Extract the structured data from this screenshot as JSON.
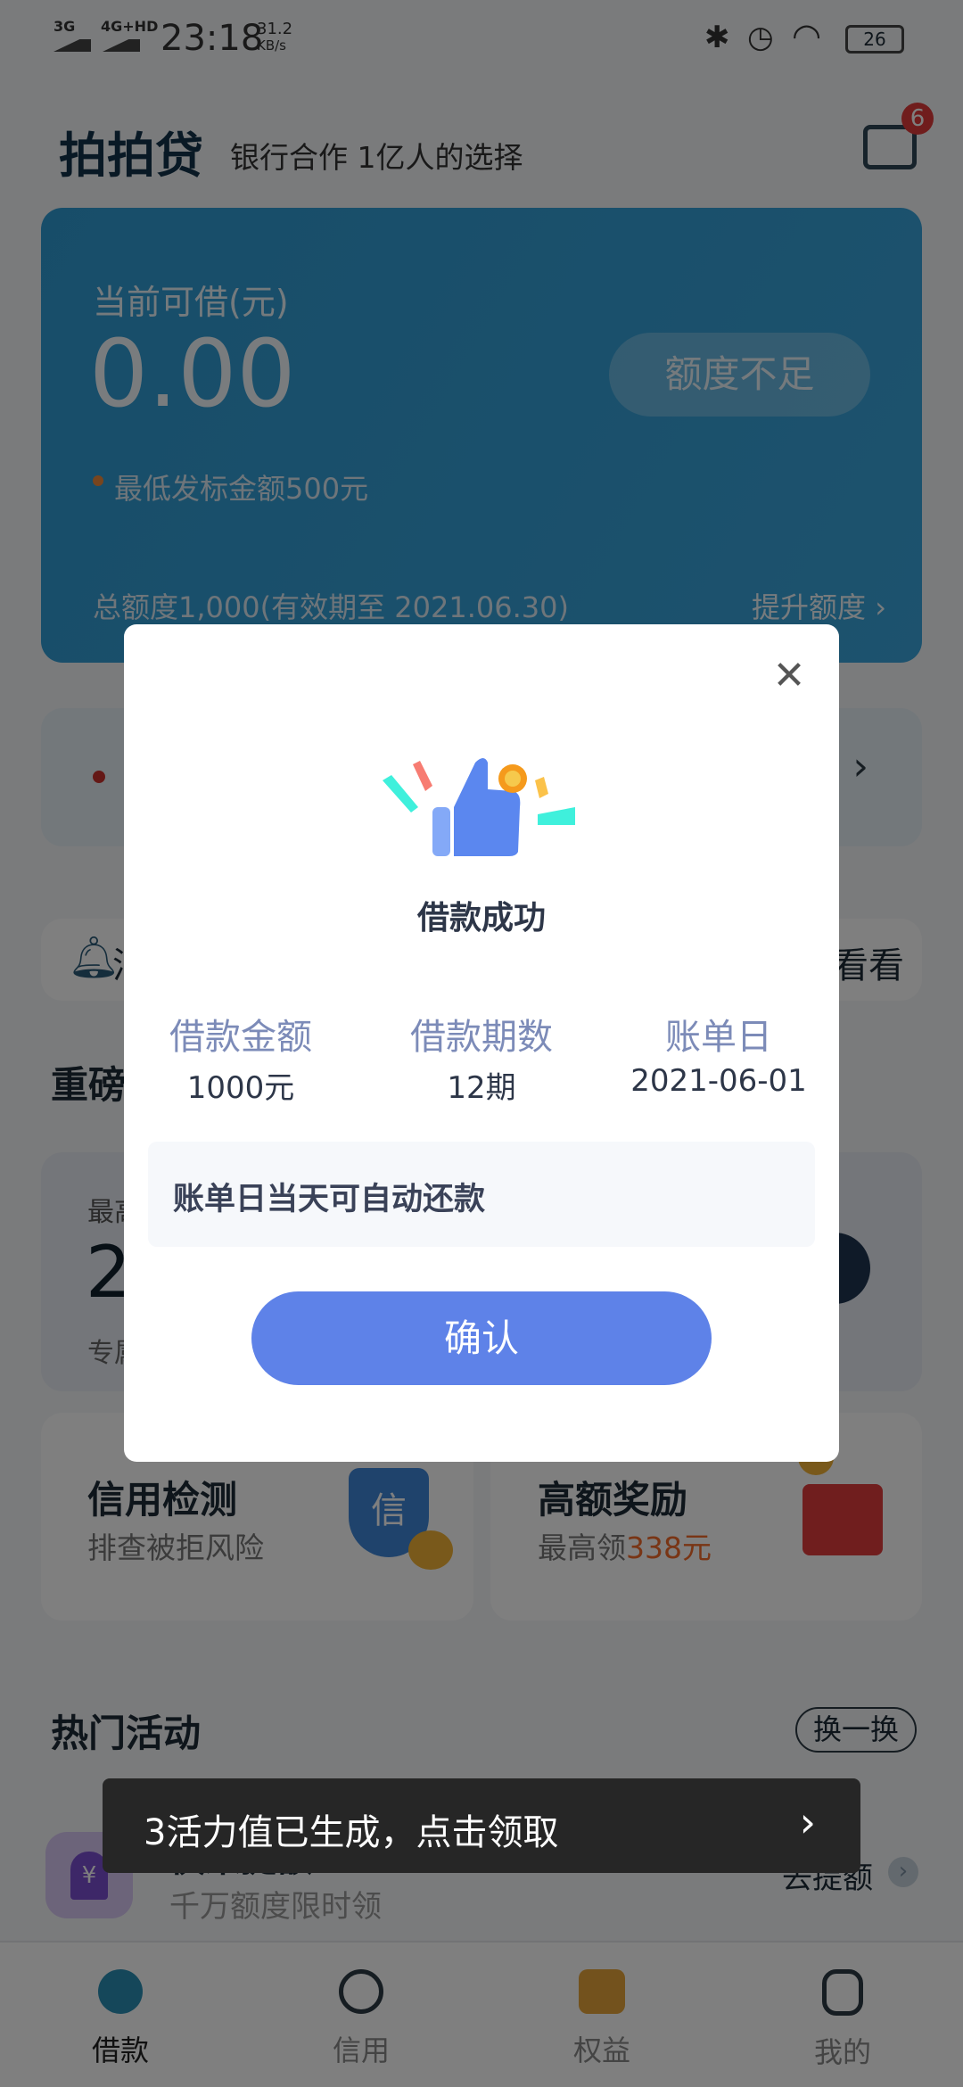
{
  "status_bar": {
    "net1": "3G",
    "net2": "4G+HD",
    "time": "23:18",
    "speed_value": "31.2",
    "speed_unit": "KB/s",
    "battery": "26"
  },
  "header": {
    "logo": "拍拍贷",
    "slogan": "银行合作 1亿人的选择",
    "message_badge": "6"
  },
  "loan_card": {
    "label": "当前可借(元)",
    "amount": "0.00",
    "button": "额度不足",
    "min_note": "最低发标金额500元",
    "total": "总额度1,000(有效期至 2021.06.30)",
    "raise_link": "提升额度",
    "color": "#3aa0d8"
  },
  "notice": {
    "partial_left": "消",
    "partial_right": "看看"
  },
  "section1": {
    "title_partial": "重磅",
    "card_label_partial": "最高",
    "card_value_partial": "2",
    "card_sub_partial": "专属"
  },
  "tiles": [
    {
      "title": "信用检测",
      "subtitle": "排查被拒风险",
      "icon_text": "信"
    },
    {
      "title": "高额奖励",
      "subtitle_prefix": "最高领",
      "subtitle_highlight": "338元"
    }
  ],
  "hot": {
    "title": "热门活动",
    "switch": "换一换",
    "item_title": "快来提额",
    "item_sub": "千万额度限时领",
    "item_action": "去提额"
  },
  "nav": [
    {
      "label": "借款",
      "active": true
    },
    {
      "label": "信用"
    },
    {
      "label": "权益"
    },
    {
      "label": "我的"
    }
  ],
  "toast": {
    "text": "3活力值已生成，点击领取"
  },
  "modal": {
    "title": "借款成功",
    "columns": [
      {
        "label": "借款金额",
        "value": "1000元"
      },
      {
        "label": "借款期数",
        "value": "12期"
      },
      {
        "label": "账单日",
        "value": "2021-06-01"
      }
    ],
    "note": "账单日当天可自动还款",
    "confirm": "确认",
    "accent": "#5e82e8"
  }
}
